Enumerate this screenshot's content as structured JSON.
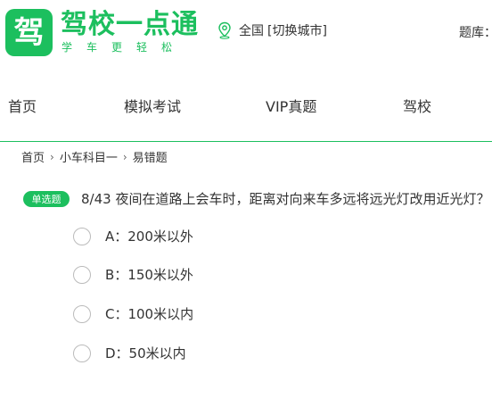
{
  "header": {
    "logo_char": "驾",
    "brand_name": "驾校一点通",
    "brand_slogan": "学车更轻松",
    "location_icon": "map-pin-icon",
    "city": "全国",
    "switch_city": "[切换城市]",
    "question_bank": "题库："
  },
  "nav": {
    "items": [
      {
        "label": "首页"
      },
      {
        "label": "模拟考试"
      },
      {
        "label": "VIP真题"
      },
      {
        "label": "驾校"
      }
    ]
  },
  "breadcrumb": {
    "items": [
      "首页",
      "小车科目一",
      "易错题"
    ],
    "separator": "›"
  },
  "question": {
    "type_badge": "单选题",
    "text": "8/43 夜间在道路上会车时，距离对向来车多远将远光灯改用近光灯？",
    "options": [
      {
        "label": "A：200米以外"
      },
      {
        "label": "B：150米以外"
      },
      {
        "label": "C：100米以内"
      },
      {
        "label": "D：50米以内"
      }
    ]
  },
  "colors": {
    "brand": "#1cbf5e",
    "text": "#333333"
  }
}
